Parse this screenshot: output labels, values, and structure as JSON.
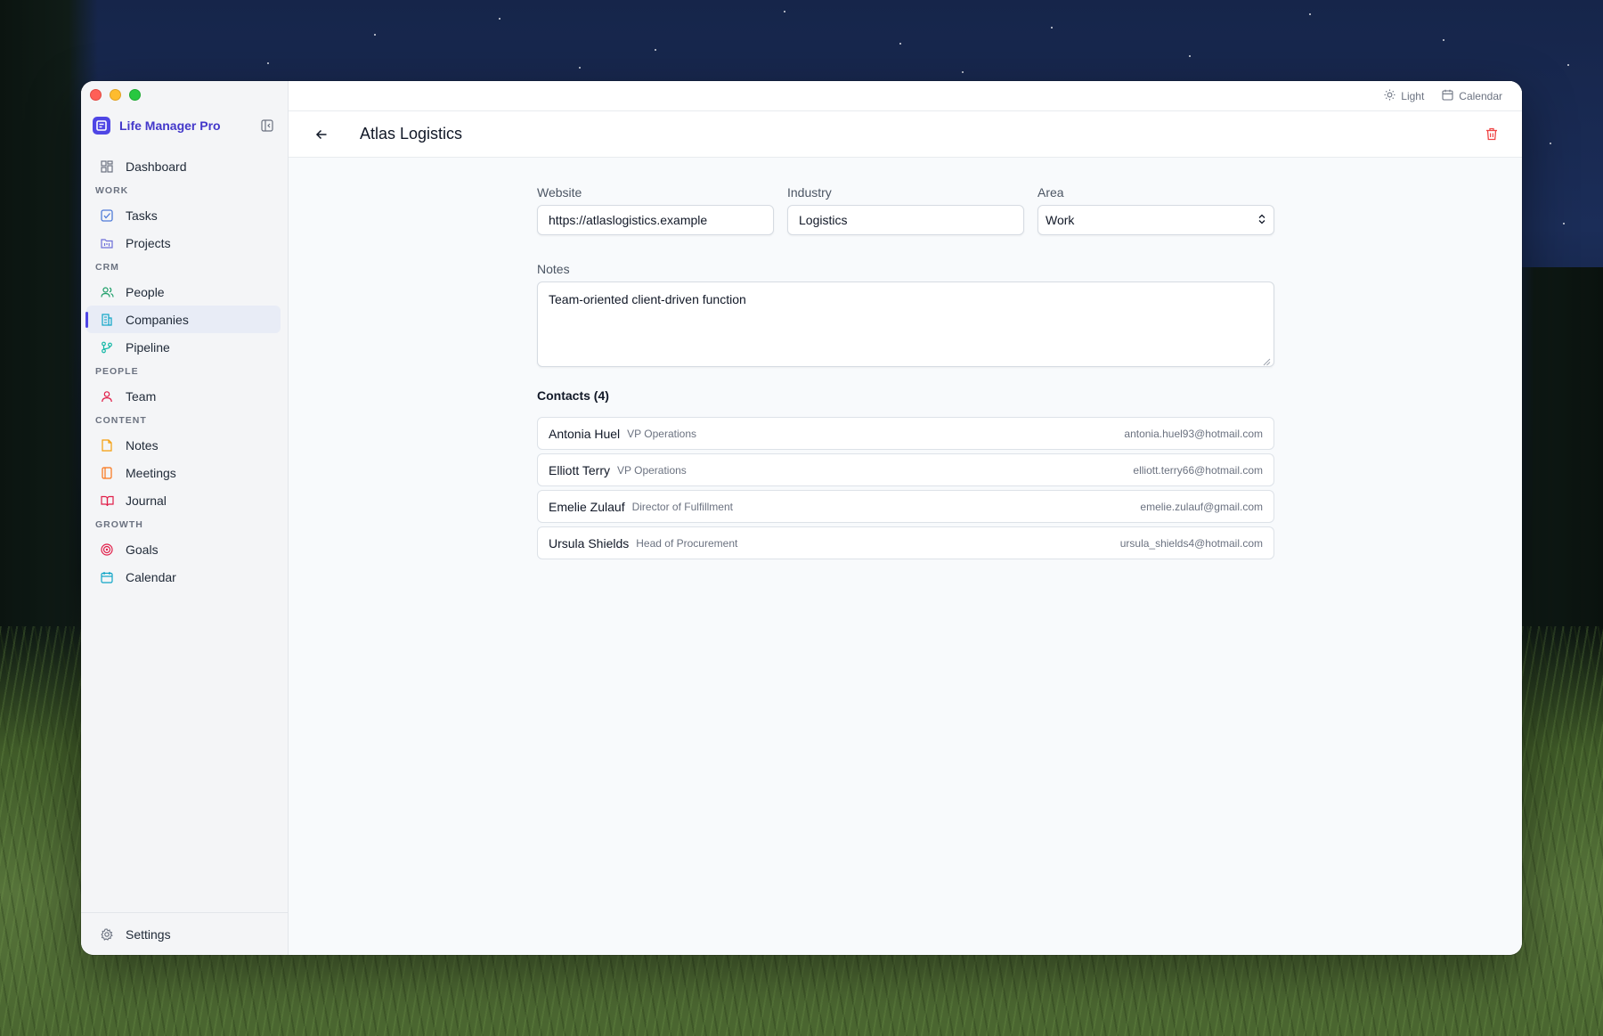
{
  "app": {
    "name": "Life Manager Pro"
  },
  "topbar": {
    "theme_label": "Light",
    "calendar_label": "Calendar"
  },
  "sidebar": {
    "dashboard": "Dashboard",
    "sections": {
      "work": "WORK",
      "crm": "CRM",
      "people": "PEOPLE",
      "content": "CONTENT",
      "growth": "GROWTH"
    },
    "items": {
      "tasks": "Tasks",
      "projects": "Projects",
      "people": "People",
      "companies": "Companies",
      "pipeline": "Pipeline",
      "team": "Team",
      "notes": "Notes",
      "meetings": "Meetings",
      "journal": "Journal",
      "goals": "Goals",
      "calendar": "Calendar"
    },
    "active_item": "Companies",
    "settings": "Settings"
  },
  "header": {
    "title": "Atlas Logistics"
  },
  "form": {
    "website_label": "Website",
    "website_value": "https://atlaslogistics.example",
    "industry_label": "Industry",
    "industry_value": "Logistics",
    "area_label": "Area",
    "area_value": "Work",
    "notes_label": "Notes",
    "notes_value": "Team-oriented client-driven function"
  },
  "contacts": {
    "title": "Contacts (4)",
    "items": [
      {
        "name": "Antonia Huel",
        "role": "VP Operations",
        "email": "antonia.huel93@hotmail.com"
      },
      {
        "name": "Elliott Terry",
        "role": "VP Operations",
        "email": "elliott.terry66@hotmail.com"
      },
      {
        "name": "Emelie Zulauf",
        "role": "Director of Fulfillment",
        "email": "emelie.zulauf@gmail.com"
      },
      {
        "name": "Ursula Shields",
        "role": "Head of Procurement",
        "email": "ursula_shields4@hotmail.com"
      }
    ]
  },
  "colors": {
    "accent": "#4f46e5",
    "danger": "#ef4444",
    "sidebar_bg": "#f4f5f7",
    "main_bg": "#f8fafc"
  },
  "icons": {
    "dashboard": "grid-icon",
    "tasks": "checkbox-icon",
    "projects": "folder-kanban-icon",
    "people": "users-icon",
    "companies": "building-icon",
    "pipeline": "git-branch-icon",
    "team": "user-icon",
    "notes": "note-icon",
    "meetings": "book-icon",
    "journal": "open-book-icon",
    "goals": "target-icon",
    "calendar": "calendar-icon",
    "settings": "gear-icon"
  }
}
